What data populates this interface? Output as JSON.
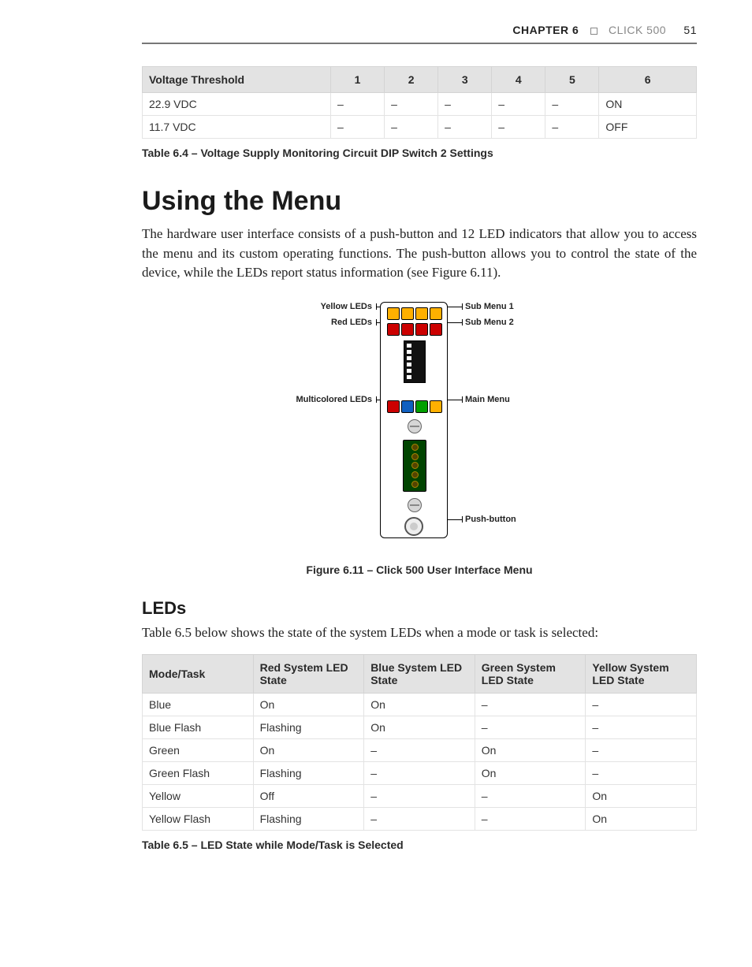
{
  "header": {
    "chapter": "CHAPTER 6",
    "product": "CLICK 500",
    "page": "51"
  },
  "table1": {
    "headers": [
      "Voltage Threshold",
      "1",
      "2",
      "3",
      "4",
      "5",
      "6"
    ],
    "rows": [
      [
        "22.9 VDC",
        "–",
        "–",
        "–",
        "–",
        "–",
        "ON"
      ],
      [
        "11.7 VDC",
        "–",
        "–",
        "–",
        "–",
        "–",
        "OFF"
      ]
    ],
    "caption": "Table 6.4 – Voltage Supply Monitoring Circuit DIP Switch 2 Settings"
  },
  "section1": {
    "title": "Using the Menu",
    "body": "The hardware user interface consists of a push-button and 12 LED indicators that allow you to access the menu and its custom operating functions. The push-button allows you to control the state of the device, while the LEDs report status information (see Figure 6.11)."
  },
  "figure": {
    "labels": {
      "yellow": "Yellow LEDs",
      "red": "Red LEDs",
      "multi": "Multicolored LEDs",
      "sub1": "Sub Menu 1",
      "sub2": "Sub Menu 2",
      "main": "Main Menu",
      "push": "Push-button"
    },
    "caption": "Figure 6.11 – Click 500 User Interface Menu"
  },
  "section2": {
    "title": "LEDs",
    "body": "Table 6.5 below shows the state of the system LEDs when a mode or task is selected:"
  },
  "table2": {
    "headers": [
      "Mode/Task",
      "Red System LED State",
      "Blue System LED State",
      "Green System LED State",
      "Yellow System LED State"
    ],
    "rows": [
      [
        "Blue",
        "On",
        "On",
        "–",
        "–"
      ],
      [
        "Blue Flash",
        "Flashing",
        "On",
        "–",
        "–"
      ],
      [
        "Green",
        "On",
        "–",
        "On",
        "–"
      ],
      [
        "Green Flash",
        "Flashing",
        "–",
        "On",
        "–"
      ],
      [
        "Yellow",
        "Off",
        "–",
        "–",
        "On"
      ],
      [
        "Yellow Flash",
        "Flashing",
        "–",
        "–",
        "On"
      ]
    ],
    "caption": "Table 6.5 – LED State while Mode/Task is Selected"
  },
  "chart_data": [
    {
      "type": "table",
      "title": "Voltage Supply Monitoring Circuit DIP Switch 2 Settings",
      "columns": [
        "Voltage Threshold",
        "1",
        "2",
        "3",
        "4",
        "5",
        "6"
      ],
      "rows": [
        [
          "22.9 VDC",
          "–",
          "–",
          "–",
          "–",
          "–",
          "ON"
        ],
        [
          "11.7 VDC",
          "–",
          "–",
          "–",
          "–",
          "–",
          "OFF"
        ]
      ]
    },
    {
      "type": "table",
      "title": "LED State while Mode/Task is Selected",
      "columns": [
        "Mode/Task",
        "Red System LED State",
        "Blue System LED State",
        "Green System LED State",
        "Yellow System LED State"
      ],
      "rows": [
        [
          "Blue",
          "On",
          "On",
          "–",
          "–"
        ],
        [
          "Blue Flash",
          "Flashing",
          "On",
          "–",
          "–"
        ],
        [
          "Green",
          "On",
          "–",
          "On",
          "–"
        ],
        [
          "Green Flash",
          "Flashing",
          "–",
          "On",
          "–"
        ],
        [
          "Yellow",
          "Off",
          "–",
          "–",
          "On"
        ],
        [
          "Yellow Flash",
          "Flashing",
          "–",
          "–",
          "On"
        ]
      ]
    }
  ]
}
